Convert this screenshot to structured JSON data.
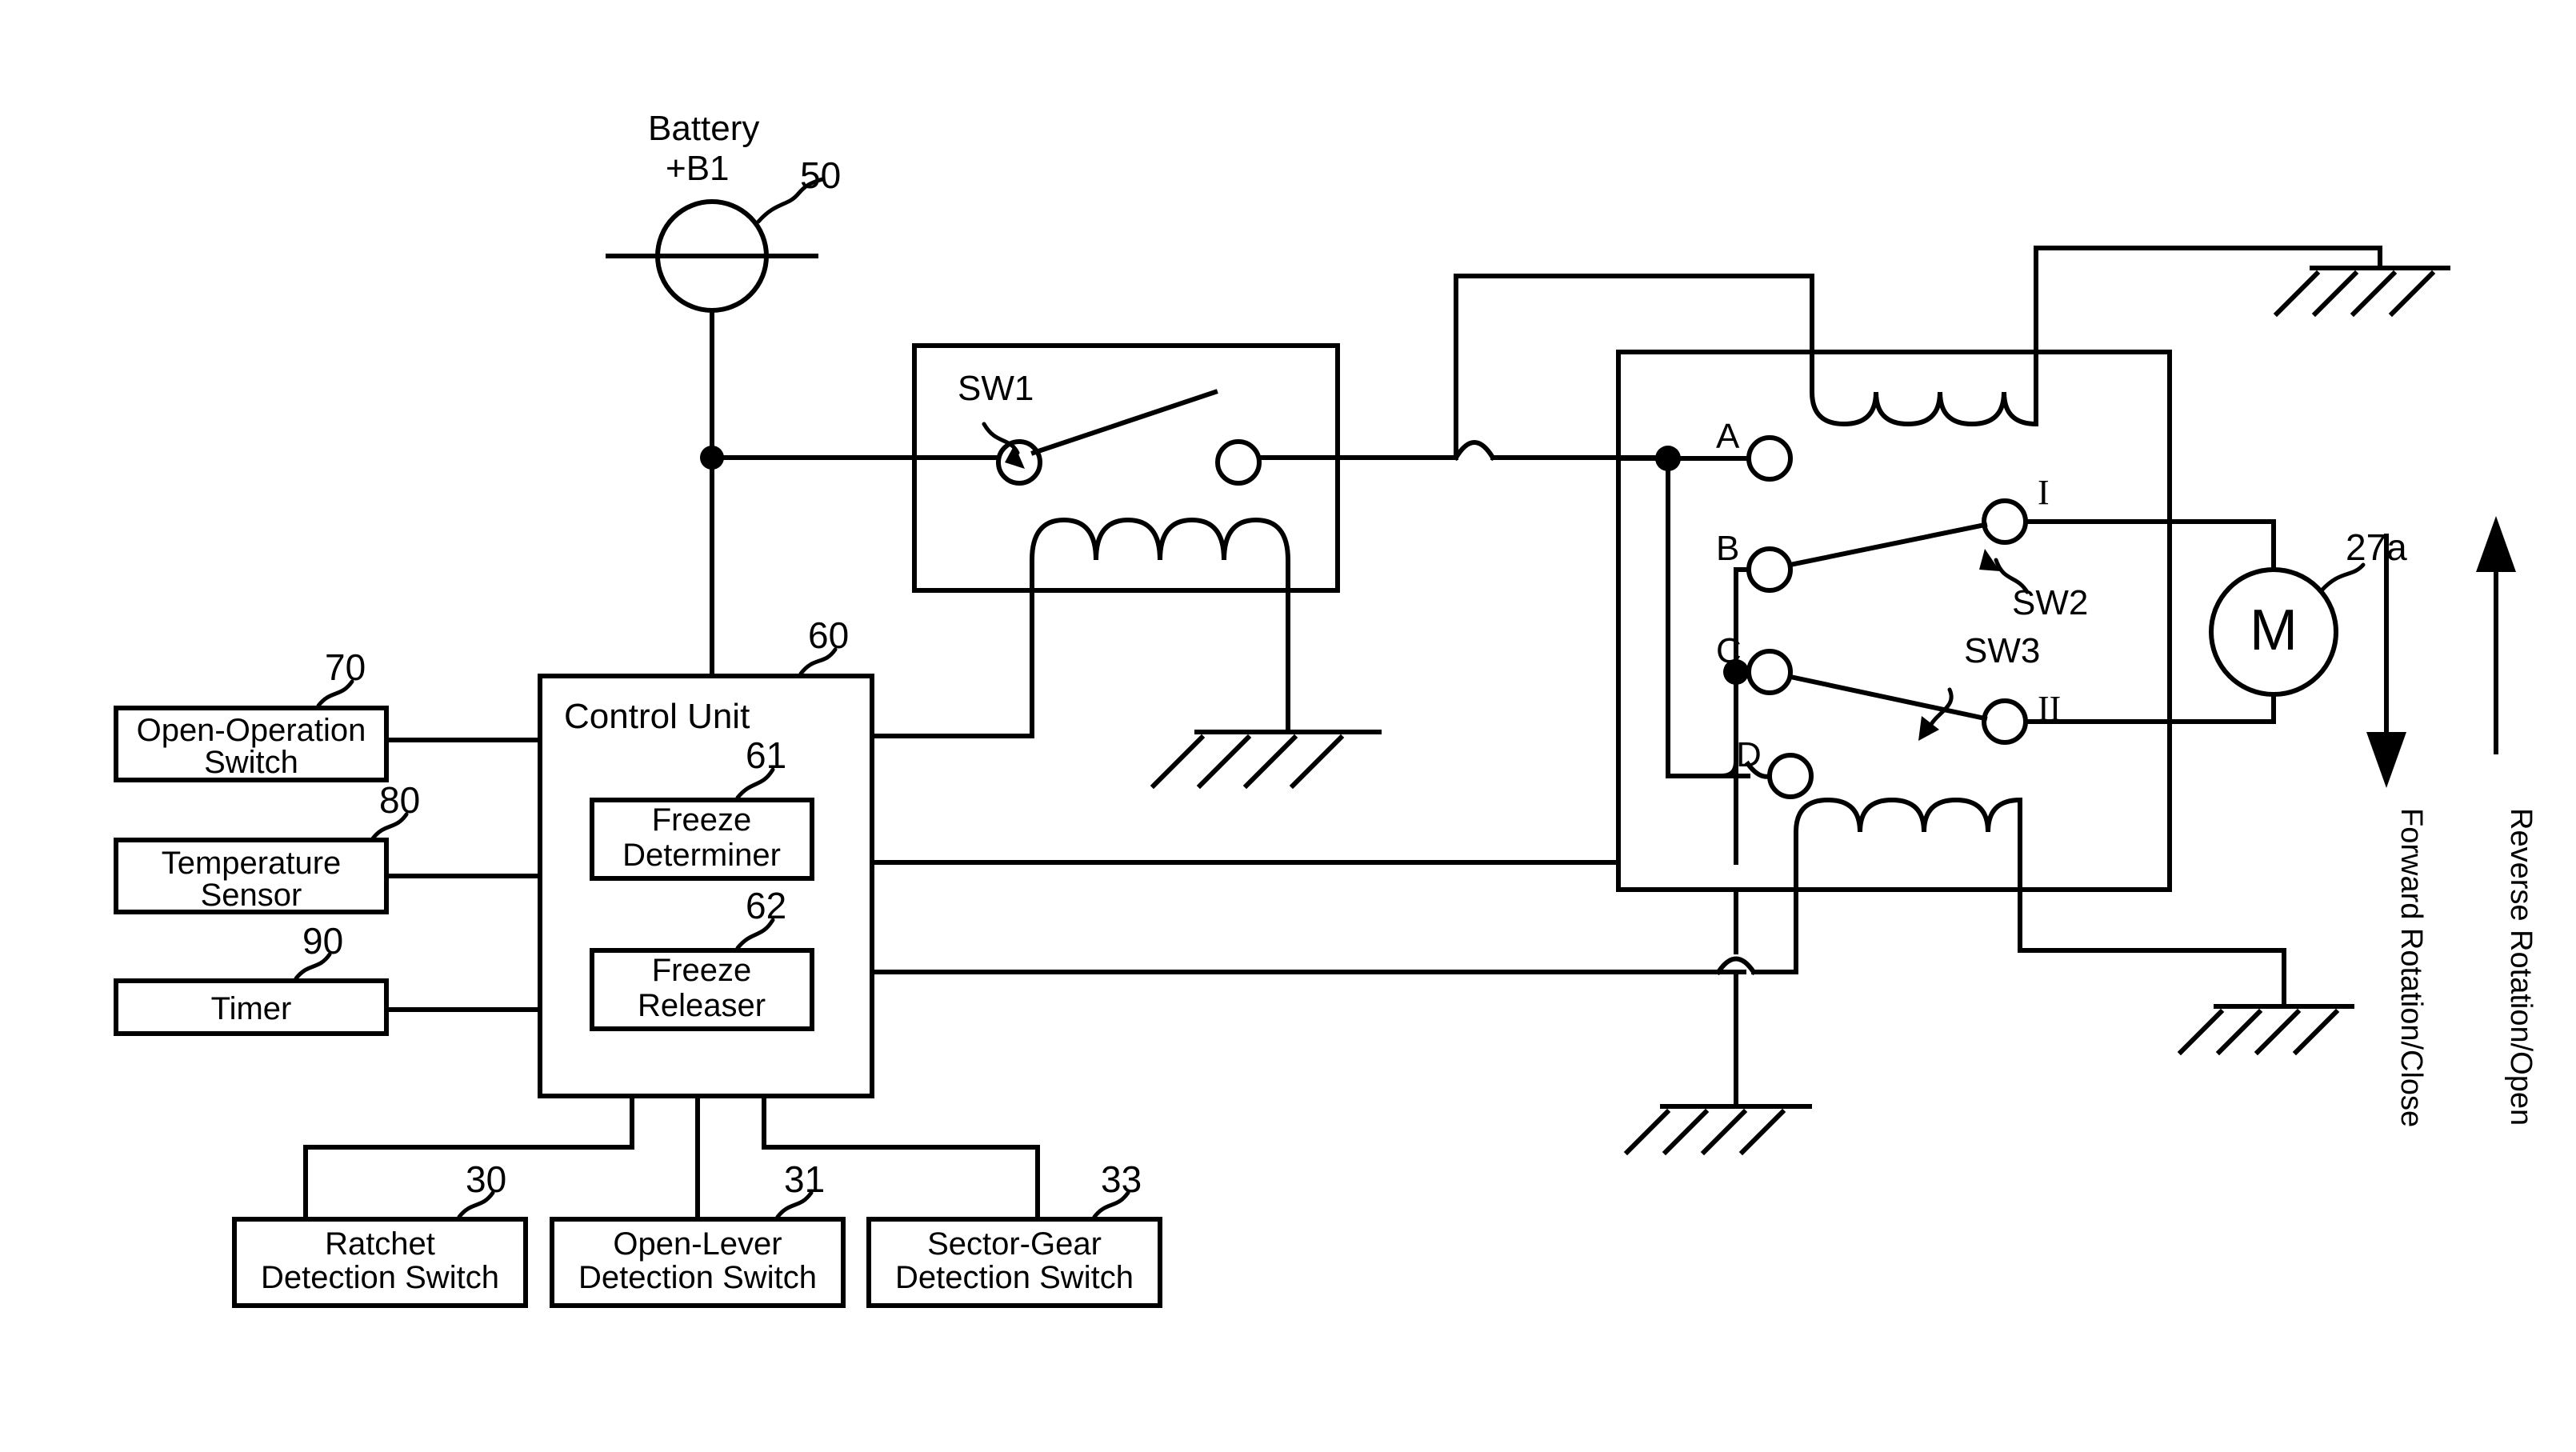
{
  "diagram": {
    "title": "Door latch motor control circuit diagram",
    "power": {
      "label_line1": "Battery",
      "label_line2": "+B1",
      "ref": "50"
    },
    "relay_sw1": {
      "name": "SW1",
      "ref_none": ""
    },
    "control_unit": {
      "title": "Control Unit",
      "ref": "60",
      "modules": [
        {
          "line1": "Freeze",
          "line2": "Determiner",
          "ref": "61"
        },
        {
          "line1": "Freeze",
          "line2": "Releaser",
          "ref": "62"
        }
      ]
    },
    "inputs": [
      {
        "line1": "Open-Operation",
        "line2": "Switch",
        "ref": "70"
      },
      {
        "line1": "Temperature",
        "line2": "Sensor",
        "ref": "80"
      },
      {
        "line1": "Timer",
        "line2": "",
        "ref": "90"
      }
    ],
    "detection_switches": [
      {
        "line1": "Ratchet",
        "line2": "Detection Switch",
        "ref": "30"
      },
      {
        "line1": "Open-Lever",
        "line2": "Detection Switch",
        "ref": "31"
      },
      {
        "line1": "Sector-Gear",
        "line2": "Detection Switch",
        "ref": "33"
      }
    ],
    "relay_block": {
      "terminals": [
        "A",
        "B",
        "C",
        "D"
      ],
      "contacts": [
        "I",
        "II"
      ],
      "switches": [
        "SW2",
        "SW3"
      ]
    },
    "motor": {
      "symbol": "M",
      "ref": "27a"
    },
    "rotation_labels": [
      {
        "text": "Forward Rotation/Close",
        "direction": "down"
      },
      {
        "text": "Reverse Rotation/Open",
        "direction": "up"
      }
    ],
    "colors": {
      "line": "#000000",
      "background": "#ffffff"
    }
  }
}
